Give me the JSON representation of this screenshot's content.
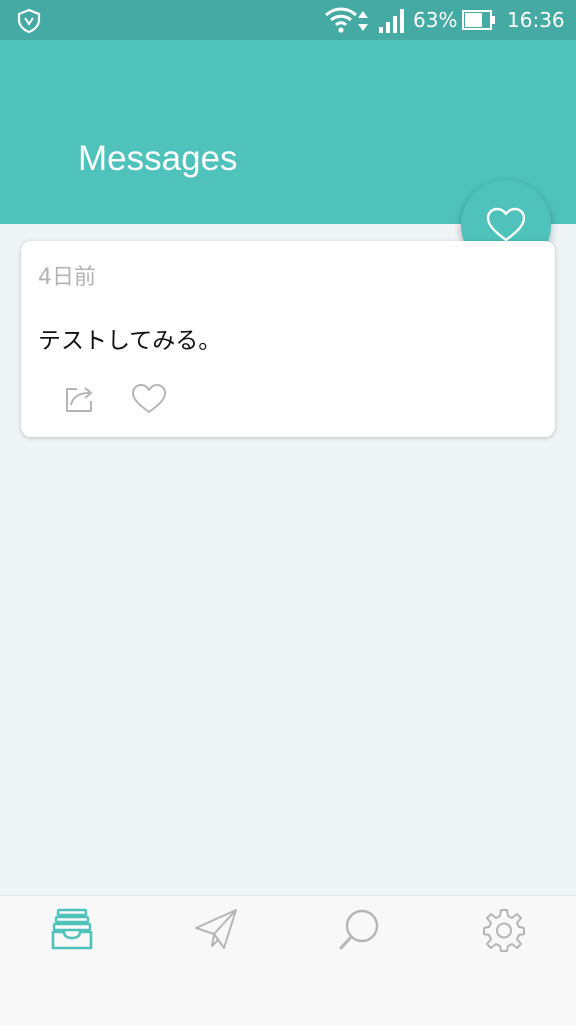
{
  "status_bar": {
    "battery_percent": "63%",
    "time": "16:36",
    "icons": [
      "shield-icon",
      "wifi-icon",
      "data-arrows-icon",
      "signal-icon",
      "battery-icon"
    ]
  },
  "header": {
    "title": "Messages"
  },
  "fab": {
    "icon": "heart-icon"
  },
  "messages": [
    {
      "time_ago": "4日前",
      "text": "テストしてみる。",
      "actions": [
        "share-icon",
        "heart-icon"
      ]
    }
  ],
  "bottom_nav": {
    "items": [
      {
        "icon": "inbox-icon",
        "active": true
      },
      {
        "icon": "paper-plane-icon",
        "active": false
      },
      {
        "icon": "search-icon",
        "active": false
      },
      {
        "icon": "gear-icon",
        "active": false
      }
    ]
  },
  "colors": {
    "accent": "#4fc2bc",
    "status_bar": "#44aaa3",
    "background": "#eff4f6",
    "inactive_icon": "#b5b5b5"
  }
}
